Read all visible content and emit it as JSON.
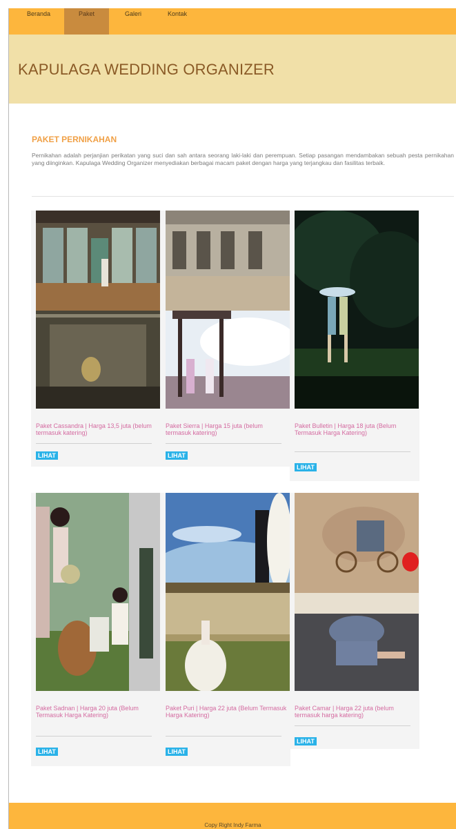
{
  "nav": {
    "items": [
      {
        "label": "Beranda"
      },
      {
        "label": "Paket"
      },
      {
        "label": "Galeri"
      },
      {
        "label": "Kontak"
      }
    ]
  },
  "header": {
    "title": "KAPULAGA WEDDING ORGANIZER"
  },
  "main": {
    "title": "PAKET PERNIKAHAN",
    "intro": "Pernikahan adalah perjanjian perikatan yang suci dan sah antara seorang laki-laki dan perempuan. Setiap pasangan mendambakan sebuah pesta pernikahan yang diinginkan. Kapulaga Wedding Organizer menyediakan berbagai macam paket dengan harga yang terjangkau dan fasilitas terbaik."
  },
  "packages": [
    {
      "caption": "Paket Cassandra | Harga 13,5 juta (belum termasuk katering)",
      "button": "LIHAT"
    },
    {
      "caption": "Paket Sierra | Harga 15 juta (belum termasuk katering)",
      "button": "LIHAT"
    },
    {
      "caption": "Paket Bulletin | Harga 18 juta (Belum Termasuk Harga Katering)",
      "button": "LIHAT"
    },
    {
      "caption": "Paket Sadnan | Harga 20 juta (Belum Termasuk Harga Katering)",
      "button": "LIHAT"
    },
    {
      "caption": "Paket Puri | Harga 22 juta (Belum Termasuk Harga Katering)",
      "button": "LIHAT"
    },
    {
      "caption": "Paket Camar | Harga 22 juta (belum termasuk harga katering)",
      "button": "LIHAT"
    }
  ],
  "footer": {
    "copyright": "Copy Right Indy Farma"
  },
  "colors": {
    "nav": "#fdb63d",
    "header": "#f1e0a8",
    "title": "#8a5a26",
    "accent": "#f0a046",
    "caption": "#d46aa0",
    "button": "#2ab2e8"
  }
}
